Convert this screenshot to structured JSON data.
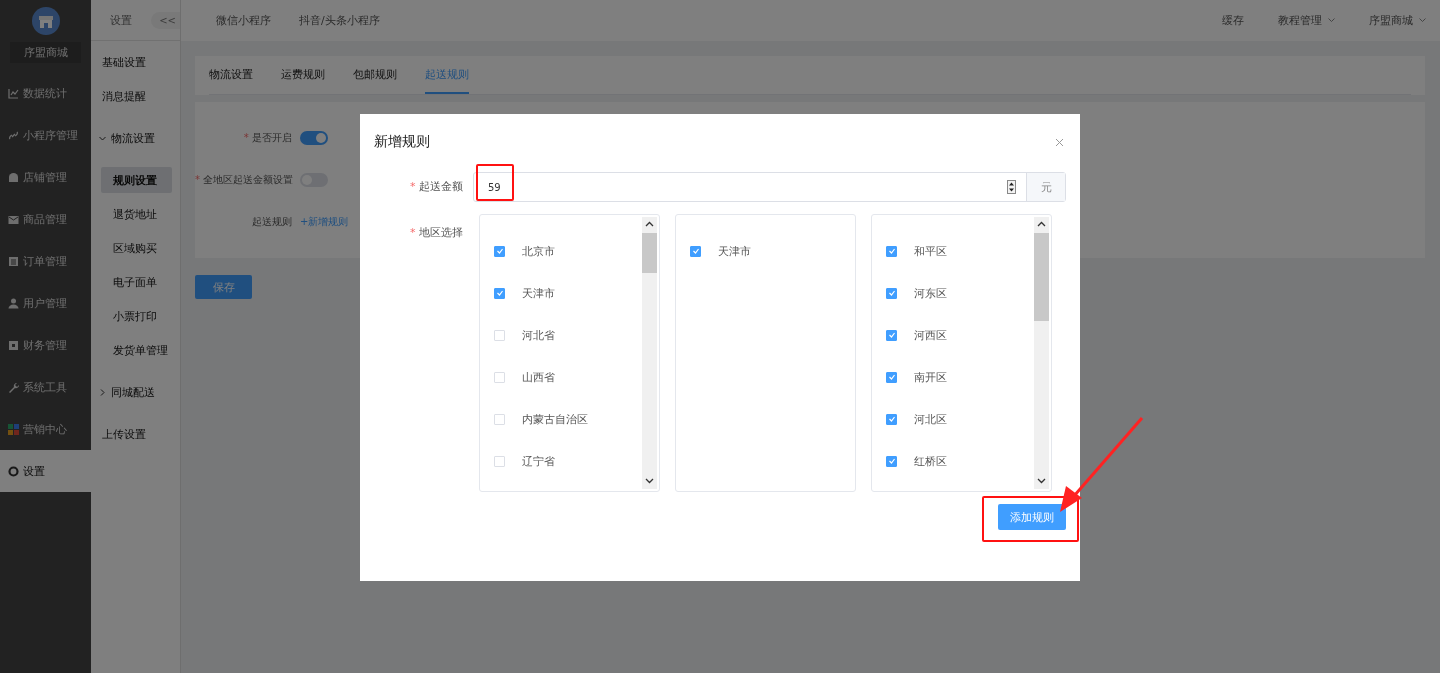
{
  "sidebar": {
    "store_name": "序盟商城",
    "items": [
      {
        "label": "数据统计",
        "selected": false
      },
      {
        "label": "小程序管理",
        "selected": false
      },
      {
        "label": "店铺管理",
        "selected": false
      },
      {
        "label": "商品管理",
        "selected": false
      },
      {
        "label": "订单管理",
        "selected": false
      },
      {
        "label": "用户管理",
        "selected": false
      },
      {
        "label": "财务管理",
        "selected": false
      },
      {
        "label": "系统工具",
        "selected": false
      },
      {
        "label": "营销中心",
        "selected": false
      },
      {
        "label": "设置",
        "selected": true
      }
    ]
  },
  "submenu": {
    "title": "设置",
    "collapse_button": "<<",
    "items": [
      {
        "kind": "link",
        "label": "基础设置",
        "selected": false
      },
      {
        "kind": "link",
        "label": "消息提醒",
        "selected": false
      },
      {
        "kind": "group",
        "label": "物流设置",
        "expanded": true,
        "children": [
          {
            "label": "规则设置",
            "selected": true
          },
          {
            "label": "退货地址",
            "selected": false
          },
          {
            "label": "区域购买",
            "selected": false
          },
          {
            "label": "电子面单",
            "selected": false
          },
          {
            "label": "小票打印",
            "selected": false
          },
          {
            "label": "发货单管理",
            "selected": false
          }
        ]
      },
      {
        "kind": "group",
        "label": "同城配送",
        "expanded": false
      },
      {
        "kind": "link",
        "label": "上传设置",
        "selected": false
      }
    ]
  },
  "topbar": {
    "tabs": [
      "微信小程序",
      "抖音/头条小程序"
    ],
    "actions": [
      {
        "label": "缓存",
        "dropdown": false
      },
      {
        "label": "教程管理",
        "dropdown": true
      },
      {
        "label": "序盟商城",
        "dropdown": true
      }
    ]
  },
  "tabs": [
    {
      "label": "物流设置",
      "selected": false
    },
    {
      "label": "运费规则",
      "selected": false
    },
    {
      "label": "包邮规则",
      "selected": false
    },
    {
      "label": "起送规则",
      "selected": true
    }
  ],
  "form": {
    "fields": [
      {
        "kind": "switch",
        "mark": "*",
        "label": "是否开启",
        "on": true
      },
      {
        "kind": "switch",
        "mark": "*",
        "label": "全地区起送金额设置",
        "on": false
      },
      {
        "kind": "link",
        "label": "起送规则",
        "link": "+新增规则"
      }
    ]
  },
  "save_button": "保存",
  "dialog": {
    "title": "新增规则",
    "amount": {
      "mark": "*",
      "label": "起送金额",
      "value": "59",
      "unit": "元"
    },
    "region": {
      "mark": "*",
      "label": "地区选择",
      "lists": [
        {
          "kind": "scrolling",
          "items": [
            {
              "label": "北京市",
              "checked": true
            },
            {
              "label": "天津市",
              "checked": true
            },
            {
              "label": "河北省",
              "checked": false
            },
            {
              "label": "山西省",
              "checked": false
            },
            {
              "label": "内蒙古自治区",
              "checked": false
            },
            {
              "label": "辽宁省",
              "checked": false
            }
          ]
        },
        {
          "kind": "plain",
          "items": [
            {
              "label": "天津市",
              "checked": true
            }
          ]
        },
        {
          "kind": "scrolling",
          "items": [
            {
              "label": "和平区",
              "checked": true
            },
            {
              "label": "河东区",
              "checked": true
            },
            {
              "label": "河西区",
              "checked": true
            },
            {
              "label": "南开区",
              "checked": true
            },
            {
              "label": "河北区",
              "checked": true
            },
            {
              "label": "红桥区",
              "checked": true
            }
          ]
        }
      ]
    },
    "submit_button": "添加规则"
  }
}
